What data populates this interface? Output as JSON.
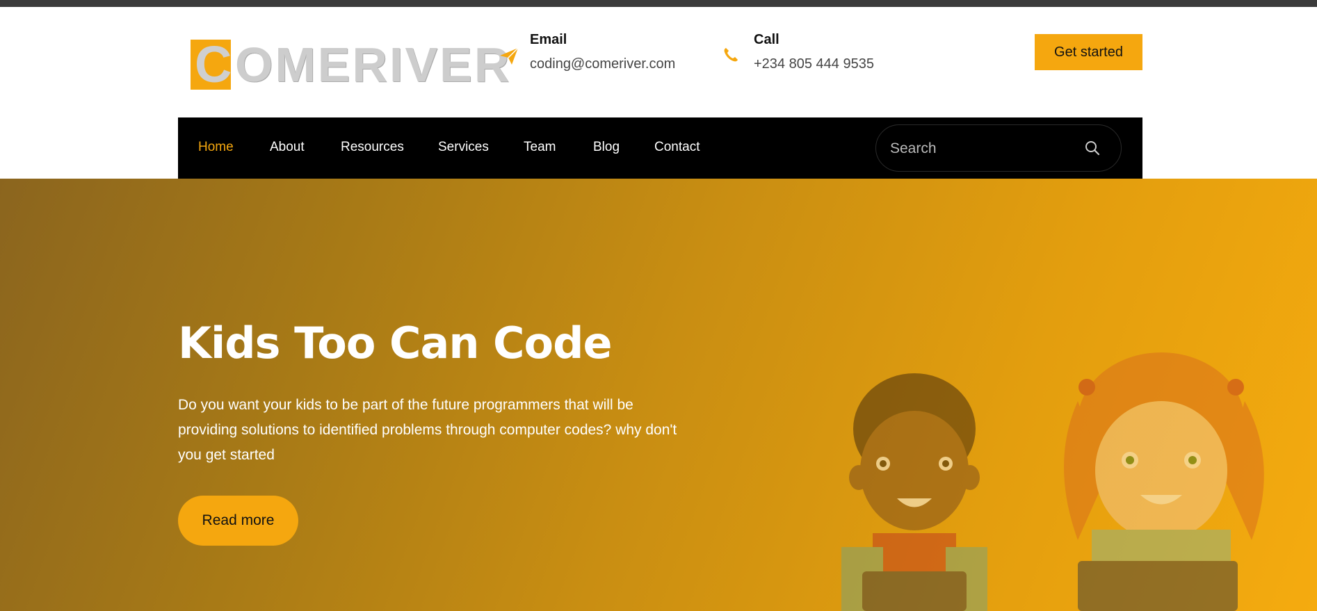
{
  "brand": {
    "logo_letter": "C",
    "logo_rest": "OMERIVER"
  },
  "header": {
    "email_label": "Email",
    "email_value": "coding@comeriver.com",
    "call_label": "Call",
    "call_value": "+234 805 444 9535",
    "cta_label": "Get started"
  },
  "nav": {
    "items": [
      {
        "label": "Home",
        "active": true
      },
      {
        "label": "About"
      },
      {
        "label": "Resources"
      },
      {
        "label": "Services"
      },
      {
        "label": "Team"
      },
      {
        "label": "Blog"
      },
      {
        "label": "Contact"
      }
    ],
    "search_placeholder": "Search"
  },
  "hero": {
    "title": "Kids Too Can Code",
    "text": "Do you want your kids to be part of the future programmers that will be providing solutions to identified problems through computer codes? why don't you get started",
    "button_label": "Read more"
  },
  "icons": {
    "email": "paper-plane-icon",
    "call": "phone-icon",
    "search": "search-icon"
  },
  "colors": {
    "accent": "#f5a70f",
    "nav_bg": "#000000",
    "hero_start": "#8b651e",
    "hero_end": "#f5ab0f"
  }
}
